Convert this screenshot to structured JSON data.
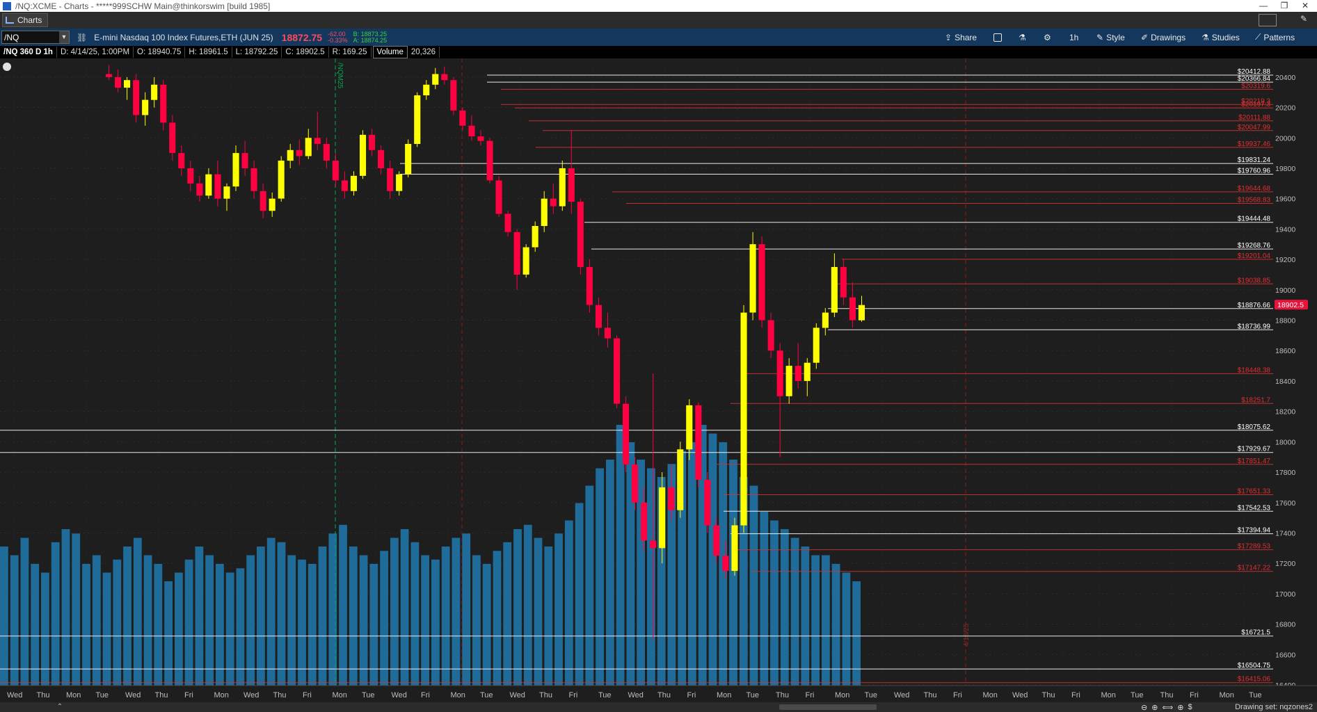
{
  "window": {
    "title": "/NQ:XCME - Charts - *****999SCHW Main@thinkorswim [build 1985]",
    "minimize": "—",
    "restore": "❐",
    "close": "✕"
  },
  "tabs": [
    {
      "label": "Charts"
    }
  ],
  "toolbar": {
    "symbol": "/NQ",
    "description": "E-mini Nasdaq 100 Index Futures,ETH (JUN 25)",
    "last_price": "18872.75",
    "net_change": "-62.00",
    "pct_change": "-0.33%",
    "bid": "B: 18873.25",
    "ask": "A: 18874.25",
    "share_label": "Share",
    "timeframe_label": "1h",
    "style_label": "Style",
    "drawings_label": "Drawings",
    "studies_label": "Studies",
    "patterns_label": "Patterns"
  },
  "infobar": {
    "chart_id": "/NQ 360 D 1h",
    "date": "D: 4/14/25, 1:00PM",
    "open": "O: 18940.75",
    "high": "H: 18961.5",
    "low": "L: 18792.25",
    "close": "C: 18902.5",
    "range": "R: 169.25",
    "volume_label": "Volume",
    "volume_value": "20,326"
  },
  "status": {
    "drawing_set": "Drawing set: nqzones2"
  },
  "colors": {
    "white_level": "#ffffff",
    "red_level": "#e03030",
    "candle_up": "#ffff00",
    "candle_down": "#ff0040",
    "volume": "#1f6b9a",
    "current_price_tag": "#e8143c",
    "expiry_marker": "#00aa55"
  },
  "chart_data": {
    "type": "candlestick",
    "timeframe": "1h",
    "y_range": [
      16400,
      20500
    ],
    "y_ticks": [
      16400,
      16600,
      16800,
      17000,
      17200,
      17400,
      17600,
      17800,
      18000,
      18200,
      18400,
      18600,
      18800,
      19000,
      19200,
      19400,
      19600,
      19800,
      20000,
      20200,
      20400
    ],
    "current_price": "18902.5",
    "markers": [
      {
        "label": "/NQM25"
      },
      {
        "label": "4/18/25"
      }
    ],
    "x_day_labels": [
      "Wed",
      "Thu",
      "Mon",
      "Tue",
      "Wed",
      "Thu",
      "Fri",
      "Mon",
      "Wed",
      "Thu",
      "Fri",
      "Mon",
      "Tue",
      "Wed",
      "Fri",
      "Mon",
      "Tue",
      "Wed",
      "Thu",
      "Fri",
      "Tue",
      "Wed",
      "Thu",
      "Fri",
      "Mon",
      "Tue",
      "Thu",
      "Fri",
      "Mon",
      "Tue",
      "Wed",
      "Thu",
      "Fri",
      "Mon",
      "Wed",
      "Thu",
      "Fri",
      "Mon",
      "Tue",
      "Thu",
      "Fri",
      "Mon",
      "Tue"
    ],
    "levels": [
      {
        "label": "$20412.88",
        "value": 20412.88,
        "color": "white"
      },
      {
        "label": "$20366.84",
        "value": 20366.84,
        "color": "white"
      },
      {
        "label": "$20319.6",
        "value": 20319.6,
        "color": "red"
      },
      {
        "label": "$20219.3",
        "value": 20219.3,
        "color": "red"
      },
      {
        "label": "$20197.3",
        "value": 20197.3,
        "color": "red"
      },
      {
        "label": "$20111.88",
        "value": 20111.88,
        "color": "red"
      },
      {
        "label": "$20047.99",
        "value": 20047.99,
        "color": "red"
      },
      {
        "label": "$19937.46",
        "value": 19937.46,
        "color": "red"
      },
      {
        "label": "$19831.24",
        "value": 19831.24,
        "color": "white"
      },
      {
        "label": "$19760.96",
        "value": 19760.96,
        "color": "white"
      },
      {
        "label": "$19644.68",
        "value": 19644.68,
        "color": "red"
      },
      {
        "label": "$19568.83",
        "value": 19568.83,
        "color": "red"
      },
      {
        "label": "$19444.48",
        "value": 19444.48,
        "color": "white"
      },
      {
        "label": "$19268.76",
        "value": 19268.76,
        "color": "white"
      },
      {
        "label": "$19201.04",
        "value": 19201.04,
        "color": "red"
      },
      {
        "label": "$19038.85",
        "value": 19038.85,
        "color": "red"
      },
      {
        "label": "$18876.66",
        "value": 18876.66,
        "color": "white"
      },
      {
        "label": "$18736.99",
        "value": 18736.99,
        "color": "white"
      },
      {
        "label": "$18448.38",
        "value": 18448.38,
        "color": "red"
      },
      {
        "label": "$18251.7",
        "value": 18251.7,
        "color": "red"
      },
      {
        "label": "$18075.62",
        "value": 18075.62,
        "color": "white"
      },
      {
        "label": "$17929.67",
        "value": 17929.67,
        "color": "white"
      },
      {
        "label": "$17851.47",
        "value": 17851.47,
        "color": "red"
      },
      {
        "label": "$17651.33",
        "value": 17651.33,
        "color": "red"
      },
      {
        "label": "$17542.53",
        "value": 17542.53,
        "color": "white"
      },
      {
        "label": "$17394.94",
        "value": 17394.94,
        "color": "white"
      },
      {
        "label": "$17289.53",
        "value": 17289.53,
        "color": "red"
      },
      {
        "label": "$17147.22",
        "value": 17147.22,
        "color": "red"
      },
      {
        "label": "$16721.5",
        "value": 16721.5,
        "color": "white"
      },
      {
        "label": "$16504.75",
        "value": 16504.75,
        "color": "white"
      },
      {
        "label": "$16415.06",
        "value": 16415.06,
        "color": "red"
      }
    ],
    "candles": [
      {
        "o": 20420,
        "h": 20480,
        "l": 20380,
        "c": 20400
      },
      {
        "o": 20400,
        "h": 20450,
        "l": 20300,
        "c": 20330
      },
      {
        "o": 20330,
        "h": 20400,
        "l": 20250,
        "c": 20380
      },
      {
        "o": 20380,
        "h": 20420,
        "l": 20100,
        "c": 20150
      },
      {
        "o": 20150,
        "h": 20300,
        "l": 20080,
        "c": 20250
      },
      {
        "o": 20250,
        "h": 20400,
        "l": 20200,
        "c": 20350
      },
      {
        "o": 20350,
        "h": 20380,
        "l": 20050,
        "c": 20100
      },
      {
        "o": 20100,
        "h": 20150,
        "l": 19850,
        "c": 19900
      },
      {
        "o": 19900,
        "h": 19950,
        "l": 19750,
        "c": 19800
      },
      {
        "o": 19800,
        "h": 19850,
        "l": 19650,
        "c": 19700
      },
      {
        "o": 19700,
        "h": 19750,
        "l": 19580,
        "c": 19620
      },
      {
        "o": 19620,
        "h": 19800,
        "l": 19600,
        "c": 19760
      },
      {
        "o": 19760,
        "h": 19850,
        "l": 19550,
        "c": 19600
      },
      {
        "o": 19600,
        "h": 19700,
        "l": 19520,
        "c": 19680
      },
      {
        "o": 19680,
        "h": 19950,
        "l": 19650,
        "c": 19900
      },
      {
        "o": 19900,
        "h": 19980,
        "l": 19750,
        "c": 19800
      },
      {
        "o": 19800,
        "h": 19850,
        "l": 19600,
        "c": 19650
      },
      {
        "o": 19650,
        "h": 19700,
        "l": 19470,
        "c": 19520
      },
      {
        "o": 19520,
        "h": 19640,
        "l": 19480,
        "c": 19600
      },
      {
        "o": 19600,
        "h": 19880,
        "l": 19580,
        "c": 19850
      },
      {
        "o": 19850,
        "h": 19960,
        "l": 19800,
        "c": 19920
      },
      {
        "o": 19920,
        "h": 19990,
        "l": 19820,
        "c": 19880
      },
      {
        "o": 19880,
        "h": 20060,
        "l": 19860,
        "c": 20000
      },
      {
        "o": 20000,
        "h": 20170,
        "l": 19920,
        "c": 19960
      },
      {
        "o": 19960,
        "h": 20000,
        "l": 19800,
        "c": 19850
      },
      {
        "o": 19850,
        "h": 19900,
        "l": 19680,
        "c": 19720
      },
      {
        "o": 19720,
        "h": 19780,
        "l": 19600,
        "c": 19650
      },
      {
        "o": 19650,
        "h": 19780,
        "l": 19620,
        "c": 19750
      },
      {
        "o": 19750,
        "h": 20050,
        "l": 19730,
        "c": 20020
      },
      {
        "o": 20020,
        "h": 20060,
        "l": 19880,
        "c": 19920
      },
      {
        "o": 19920,
        "h": 19950,
        "l": 19760,
        "c": 19800
      },
      {
        "o": 19800,
        "h": 19850,
        "l": 19600,
        "c": 19650
      },
      {
        "o": 19650,
        "h": 19780,
        "l": 19620,
        "c": 19760
      },
      {
        "o": 19760,
        "h": 19990,
        "l": 19740,
        "c": 19960
      },
      {
        "o": 19960,
        "h": 20300,
        "l": 19940,
        "c": 20280
      },
      {
        "o": 20280,
        "h": 20380,
        "l": 20250,
        "c": 20350
      },
      {
        "o": 20350,
        "h": 20460,
        "l": 20320,
        "c": 20420
      },
      {
        "o": 20420,
        "h": 20470,
        "l": 20350,
        "c": 20380
      },
      {
        "o": 20380,
        "h": 20400,
        "l": 20150,
        "c": 20180
      },
      {
        "o": 20180,
        "h": 20200,
        "l": 20050,
        "c": 20080
      },
      {
        "o": 20080,
        "h": 20150,
        "l": 19980,
        "c": 20010
      },
      {
        "o": 20010,
        "h": 20050,
        "l": 19950,
        "c": 19980
      },
      {
        "o": 19980,
        "h": 20000,
        "l": 19700,
        "c": 19720
      },
      {
        "o": 19720,
        "h": 19750,
        "l": 19480,
        "c": 19500
      },
      {
        "o": 19500,
        "h": 19520,
        "l": 19350,
        "c": 19380
      },
      {
        "o": 19380,
        "h": 19400,
        "l": 19000,
        "c": 19100
      },
      {
        "o": 19100,
        "h": 19300,
        "l": 19080,
        "c": 19280
      },
      {
        "o": 19280,
        "h": 19450,
        "l": 19250,
        "c": 19420
      },
      {
        "o": 19420,
        "h": 19650,
        "l": 19380,
        "c": 19600
      },
      {
        "o": 19600,
        "h": 19700,
        "l": 19500,
        "c": 19550
      },
      {
        "o": 19550,
        "h": 19850,
        "l": 19520,
        "c": 19800
      },
      {
        "o": 19800,
        "h": 20050,
        "l": 19500,
        "c": 19580
      },
      {
        "o": 19580,
        "h": 19600,
        "l": 19100,
        "c": 19150
      },
      {
        "o": 19150,
        "h": 19200,
        "l": 18850,
        "c": 18900
      },
      {
        "o": 18900,
        "h": 18950,
        "l": 18700,
        "c": 18750
      },
      {
        "o": 18750,
        "h": 18850,
        "l": 18620,
        "c": 18680
      },
      {
        "o": 18680,
        "h": 18700,
        "l": 18220,
        "c": 18250
      },
      {
        "o": 18250,
        "h": 18300,
        "l": 17800,
        "c": 17850
      },
      {
        "o": 17850,
        "h": 17900,
        "l": 17550,
        "c": 17600
      },
      {
        "o": 17600,
        "h": 17700,
        "l": 17280,
        "c": 17350
      },
      {
        "o": 17350,
        "h": 18450,
        "l": 16700,
        "c": 17300
      },
      {
        "o": 17300,
        "h": 17800,
        "l": 17200,
        "c": 17700
      },
      {
        "o": 17700,
        "h": 17850,
        "l": 17480,
        "c": 17550
      },
      {
        "o": 17550,
        "h": 18000,
        "l": 17500,
        "c": 17950
      },
      {
        "o": 17950,
        "h": 18280,
        "l": 17880,
        "c": 18240
      },
      {
        "o": 18240,
        "h": 18260,
        "l": 17700,
        "c": 17750
      },
      {
        "o": 17750,
        "h": 17800,
        "l": 17400,
        "c": 17450
      },
      {
        "o": 17450,
        "h": 17500,
        "l": 17200,
        "c": 17250
      },
      {
        "o": 17250,
        "h": 17350,
        "l": 17100,
        "c": 17150
      },
      {
        "o": 17150,
        "h": 17500,
        "l": 17120,
        "c": 17450
      },
      {
        "o": 17450,
        "h": 18900,
        "l": 17400,
        "c": 18850
      },
      {
        "o": 18850,
        "h": 19380,
        "l": 18800,
        "c": 19300
      },
      {
        "o": 19300,
        "h": 19350,
        "l": 18750,
        "c": 18800
      },
      {
        "o": 18800,
        "h": 18850,
        "l": 18550,
        "c": 18600
      },
      {
        "o": 18600,
        "h": 18650,
        "l": 17900,
        "c": 18300
      },
      {
        "o": 18300,
        "h": 18550,
        "l": 18250,
        "c": 18500
      },
      {
        "o": 18500,
        "h": 18650,
        "l": 18350,
        "c": 18400
      },
      {
        "o": 18400,
        "h": 18550,
        "l": 18300,
        "c": 18520
      },
      {
        "o": 18520,
        "h": 18780,
        "l": 18480,
        "c": 18750
      },
      {
        "o": 18750,
        "h": 18880,
        "l": 18700,
        "c": 18850
      },
      {
        "o": 18850,
        "h": 19240,
        "l": 18820,
        "c": 19150
      },
      {
        "o": 19150,
        "h": 19200,
        "l": 18900,
        "c": 18950
      },
      {
        "o": 18950,
        "h": 19050,
        "l": 18750,
        "c": 18800
      },
      {
        "o": 18800,
        "h": 18960,
        "l": 18790,
        "c": 18900
      }
    ],
    "volume": [
      160,
      150,
      170,
      140,
      130,
      165,
      180,
      175,
      140,
      150,
      130,
      145,
      160,
      170,
      150,
      140,
      120,
      130,
      145,
      160,
      150,
      140,
      130,
      135,
      150,
      160,
      170,
      165,
      150,
      145,
      140,
      160,
      175,
      185,
      160,
      150,
      140,
      155,
      170,
      180,
      165,
      150,
      145,
      160,
      170,
      175,
      150,
      140,
      155,
      165,
      180,
      185,
      170,
      160,
      175,
      190,
      210,
      230,
      250,
      260,
      300,
      280,
      260,
      250,
      240,
      255,
      270,
      280,
      300,
      290,
      280,
      260,
      240,
      230,
      200,
      190,
      180,
      170,
      160,
      150,
      150,
      140,
      130,
      120
    ]
  }
}
